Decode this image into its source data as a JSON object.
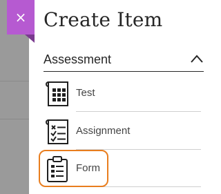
{
  "panel": {
    "title": "Create Item",
    "close_label": "×",
    "close_icon": "close-icon",
    "accent_color": "#b65ad1",
    "focus_color": "#e87d1e"
  },
  "section": {
    "label": "Assessment",
    "expanded": true,
    "toggle_icon": "chevron-up-icon"
  },
  "items": [
    {
      "label": "Test",
      "icon": "grid-checklist-icon"
    },
    {
      "label": "Assignment",
      "icon": "check-x-list-icon"
    },
    {
      "label": "Form",
      "icon": "clipboard-form-icon"
    }
  ]
}
